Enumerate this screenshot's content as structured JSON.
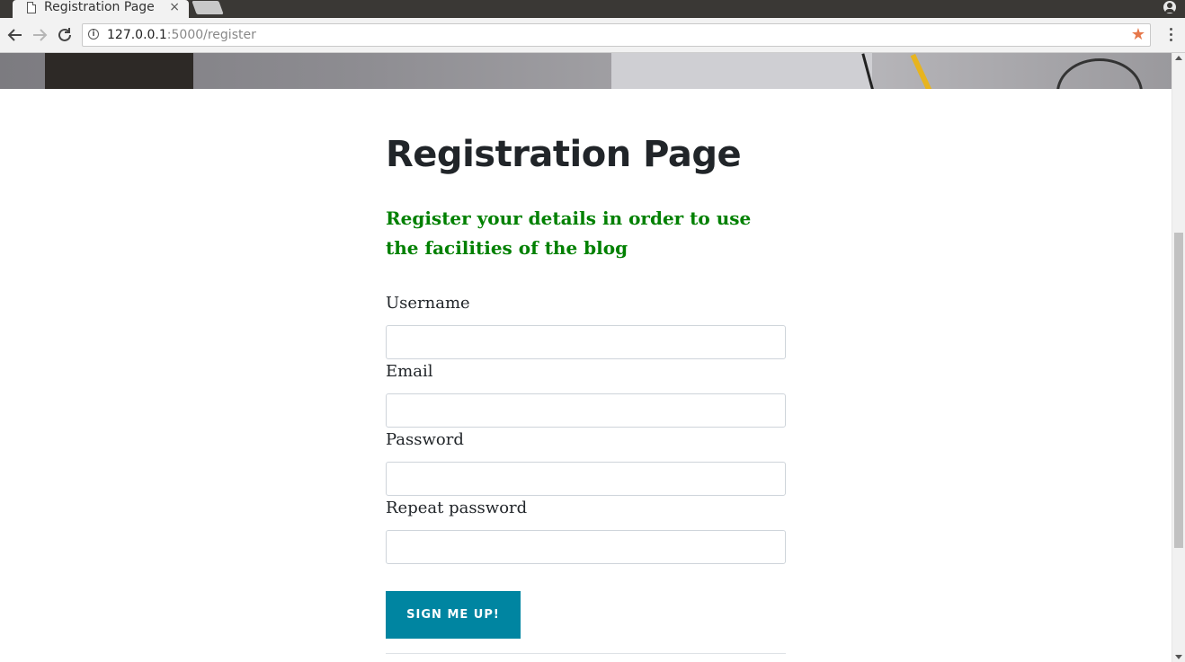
{
  "browser": {
    "tab_title": "Registration Page",
    "tab_close": "×",
    "url_host": "127.0.0.1",
    "url_rest": ":5000/register",
    "info_glyph": "i",
    "star_glyph": "★",
    "star_color": "#e6774a"
  },
  "page": {
    "title": "Registration Page",
    "subtitle": "Register your details in order to use the facilities of the blog",
    "subtitle_color": "#008000",
    "form": {
      "fields": [
        {
          "label": "Username",
          "value": ""
        },
        {
          "label": "Email",
          "value": ""
        },
        {
          "label": "Password",
          "value": ""
        },
        {
          "label": "Repeat password",
          "value": ""
        }
      ],
      "submit_label": "SIGN ME UP!",
      "submit_color": "#0085a1"
    }
  }
}
